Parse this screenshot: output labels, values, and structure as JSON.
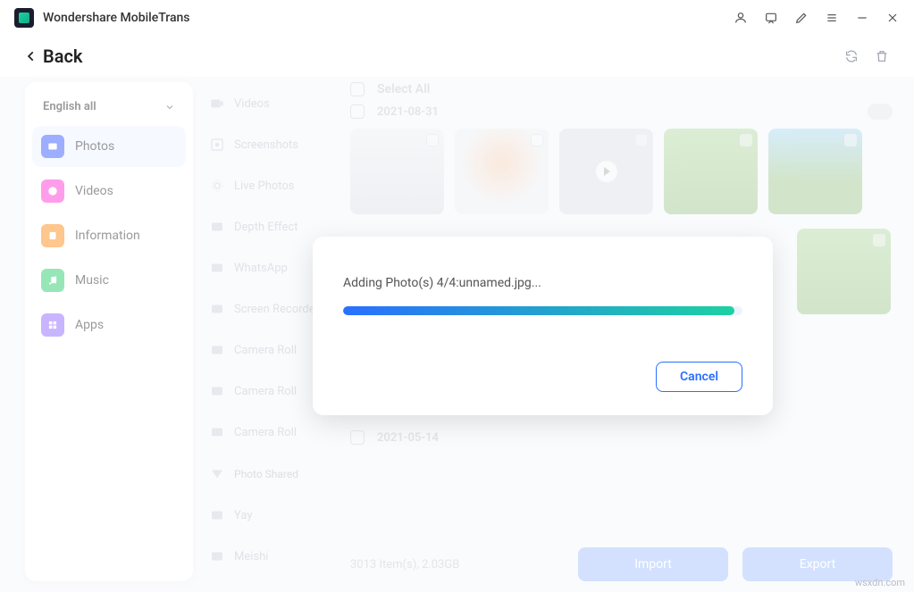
{
  "app": {
    "title": "Wondershare MobileTrans"
  },
  "nav": {
    "back": "Back"
  },
  "sidebar1": {
    "selector": "English all",
    "items": [
      {
        "label": "Photos"
      },
      {
        "label": "Videos"
      },
      {
        "label": "Information"
      },
      {
        "label": "Music"
      },
      {
        "label": "Apps"
      }
    ]
  },
  "sidebar2": {
    "items": [
      "Videos",
      "Screenshots",
      "Live Photos",
      "Depth Effect",
      "WhatsApp",
      "Screen Recorder",
      "Camera Roll",
      "Camera Roll",
      "Camera Roll"
    ],
    "section": "Photo Shared",
    "extra": [
      "Yay",
      "Meishi"
    ]
  },
  "list": {
    "select_all": "Select All",
    "group1_date": "2021-08-31",
    "group2_date": "2021-05-14",
    "footer_stats": "3013 Item(s), 2.03GB",
    "import": "Import",
    "export": "Export"
  },
  "modal": {
    "text": "Adding Photo(s) 4/4:unnamed.jpg...",
    "cancel": "Cancel"
  },
  "watermark": "wsxdn.com"
}
